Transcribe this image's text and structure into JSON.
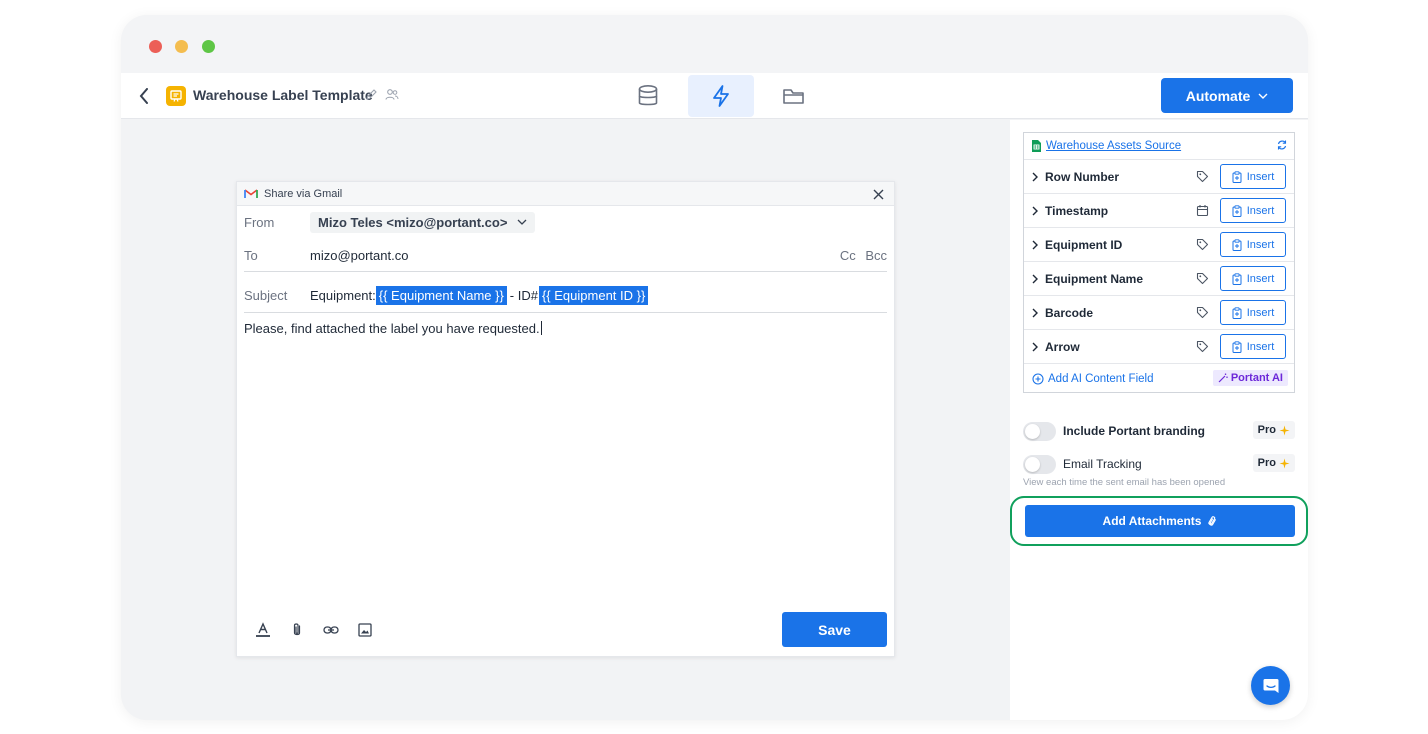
{
  "window": {
    "traffic_lights": [
      {
        "name": "close",
        "color": "#ec5f57"
      },
      {
        "name": "minimize",
        "color": "#f4bd4f"
      },
      {
        "name": "zoom",
        "color": "#5ec646"
      }
    ]
  },
  "header": {
    "title": "Warehouse Label Template",
    "tabs": [
      {
        "icon": "database-icon",
        "active": false
      },
      {
        "icon": "lightning-icon",
        "active": true
      },
      {
        "icon": "folder-icon",
        "active": false
      }
    ],
    "automate_label": "Automate"
  },
  "dialog": {
    "title": "Share via Gmail",
    "from_label": "From",
    "from_value": "Mizo Teles <mizo@portant.co>",
    "to_label": "To",
    "to_value": "mizo@portant.co",
    "cc_label": "Cc",
    "bcc_label": "Bcc",
    "subject_label": "Subject",
    "subject_prefix": "Equipment:",
    "subject_tag_1": "{{ Equipment Name }}",
    "subject_mid": "- ID#",
    "subject_tag_2": "{{ Equipment ID }}",
    "body": "Please, find attached the label you have requested.",
    "save_label": "Save"
  },
  "sidebar": {
    "source_name": "Warehouse Assets Source",
    "fields": [
      {
        "name": "Row Number",
        "type_icon": "tag-icon",
        "insert_label": "Insert"
      },
      {
        "name": "Timestamp",
        "type_icon": "calendar-icon",
        "insert_label": "Insert"
      },
      {
        "name": "Equipment ID",
        "type_icon": "tag-icon",
        "insert_label": "Insert"
      },
      {
        "name": "Equipment Name",
        "type_icon": "tag-icon",
        "insert_label": "Insert"
      },
      {
        "name": "Barcode",
        "type_icon": "tag-icon",
        "insert_label": "Insert"
      },
      {
        "name": "Arrow",
        "type_icon": "tag-icon",
        "insert_label": "Insert"
      }
    ],
    "add_ai_label": "Add AI Content Field",
    "ai_badge": "Portant AI",
    "branding_label": "Include Portant branding",
    "tracking_label": "Email Tracking",
    "pro_label": "Pro",
    "tracking_help": "View each time the sent email has been opened",
    "attachments_label": "Add Attachments"
  },
  "colors": {
    "primary": "#1a73e8",
    "highlight_border": "#10a05c",
    "doc_icon": "#f5b301"
  }
}
